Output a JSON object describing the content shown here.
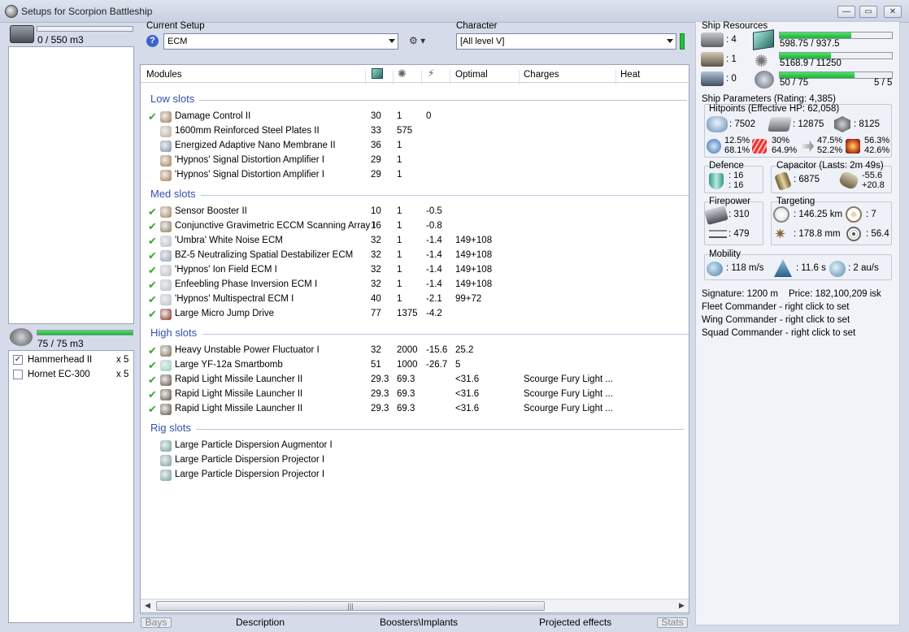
{
  "window": {
    "title": "Setups for Scorpion Battleship"
  },
  "left": {
    "cargo_value": "0 / 550 m3",
    "cargo_fill": 0,
    "drone_value": "75 / 75 m3",
    "drone_fill": 1,
    "drones": [
      {
        "name": "Hammerhead II",
        "count": "x 5",
        "checked": true
      },
      {
        "name": "Hornet EC-300",
        "count": "x 5",
        "checked": false
      }
    ]
  },
  "setup": {
    "label": "Current Setup",
    "value": "ECM"
  },
  "character": {
    "label": "Character",
    "value": "[All level V]"
  },
  "modules": {
    "headers": {
      "name": "Modules",
      "optimal": "Optimal",
      "charges": "Charges",
      "heat": "Heat"
    },
    "low": {
      "title": "Low slots",
      "items": [
        {
          "checked": true,
          "name": "Damage Control II",
          "c1": "30",
          "c2": "1",
          "c3": "0",
          "optimal": "",
          "charges": ""
        },
        {
          "checked": false,
          "name": "1600mm Reinforced Steel Plates II",
          "c1": "33",
          "c2": "575",
          "c3": "",
          "optimal": "",
          "charges": ""
        },
        {
          "checked": false,
          "name": "Energized Adaptive Nano Membrane II",
          "c1": "36",
          "c2": "1",
          "c3": "",
          "optimal": "",
          "charges": ""
        },
        {
          "checked": false,
          "name": "'Hypnos' Signal Distortion Amplifier I",
          "c1": "29",
          "c2": "1",
          "c3": "",
          "optimal": "",
          "charges": ""
        },
        {
          "checked": false,
          "name": "'Hypnos' Signal Distortion Amplifier I",
          "c1": "29",
          "c2": "1",
          "c3": "",
          "optimal": "",
          "charges": ""
        }
      ]
    },
    "med": {
      "title": "Med slots",
      "items": [
        {
          "checked": true,
          "name": "Sensor Booster II",
          "c1": "10",
          "c2": "1",
          "c3": "-0.5",
          "optimal": "",
          "charges": ""
        },
        {
          "checked": true,
          "name": "Conjunctive Gravimetric ECCM Scanning Array I",
          "c1": "16",
          "c2": "1",
          "c3": "-0.8",
          "optimal": "",
          "charges": ""
        },
        {
          "checked": true,
          "name": "'Umbra' White Noise ECM",
          "c1": "32",
          "c2": "1",
          "c3": "-1.4",
          "optimal": "149+108",
          "charges": ""
        },
        {
          "checked": true,
          "name": "BZ-5 Neutralizing Spatial Destabilizer ECM",
          "c1": "32",
          "c2": "1",
          "c3": "-1.4",
          "optimal": "149+108",
          "charges": ""
        },
        {
          "checked": true,
          "name": "'Hypnos' Ion Field ECM I",
          "c1": "32",
          "c2": "1",
          "c3": "-1.4",
          "optimal": "149+108",
          "charges": ""
        },
        {
          "checked": true,
          "name": "Enfeebling Phase Inversion ECM I",
          "c1": "32",
          "c2": "1",
          "c3": "-1.4",
          "optimal": "149+108",
          "charges": ""
        },
        {
          "checked": true,
          "name": "'Hypnos' Multispectral ECM I",
          "c1": "40",
          "c2": "1",
          "c3": "-2.1",
          "optimal": "99+72",
          "charges": ""
        },
        {
          "checked": true,
          "name": "Large Micro Jump Drive",
          "c1": "77",
          "c2": "1375",
          "c3": "-4.2",
          "optimal": "",
          "charges": ""
        }
      ]
    },
    "high": {
      "title": "High slots",
      "items": [
        {
          "checked": true,
          "name": "Heavy Unstable Power Fluctuator I",
          "c1": "32",
          "c2": "2000",
          "c3": "-15.6",
          "optimal": "25.2",
          "charges": ""
        },
        {
          "checked": true,
          "name": "Large YF-12a Smartbomb",
          "c1": "51",
          "c2": "1000",
          "c3": "-26.7",
          "optimal": "5",
          "charges": ""
        },
        {
          "checked": true,
          "name": "Rapid Light Missile Launcher II",
          "c1": "29.3",
          "c2": "69.3",
          "c3": "",
          "optimal": "<31.6",
          "charges": "Scourge Fury Light ..."
        },
        {
          "checked": true,
          "name": "Rapid Light Missile Launcher II",
          "c1": "29.3",
          "c2": "69.3",
          "c3": "",
          "optimal": "<31.6",
          "charges": "Scourge Fury Light ..."
        },
        {
          "checked": true,
          "name": "Rapid Light Missile Launcher II",
          "c1": "29.3",
          "c2": "69.3",
          "c3": "",
          "optimal": "<31.6",
          "charges": "Scourge Fury Light ..."
        }
      ]
    },
    "rig": {
      "title": "Rig slots",
      "items": [
        {
          "checked": false,
          "name": "Large Particle Dispersion Augmentor I",
          "c1": "",
          "c2": "",
          "c3": "",
          "optimal": "",
          "charges": ""
        },
        {
          "checked": false,
          "name": "Large Particle Dispersion Projector I",
          "c1": "",
          "c2": "",
          "c3": "",
          "optimal": "",
          "charges": ""
        },
        {
          "checked": false,
          "name": "Large Particle Dispersion Projector I",
          "c1": "",
          "c2": "",
          "c3": "",
          "optimal": "",
          "charges": ""
        }
      ]
    }
  },
  "tabs": {
    "bays": "Bays",
    "description": "Description",
    "boosters": "Boosters\\Implants",
    "projected": "Projected effects",
    "stats": "Stats"
  },
  "resources": {
    "title": "Ship Resources",
    "turrets": ": 4",
    "launchers": ": 1",
    "calibrations": ": 0",
    "cpu": "598.75 / 937.5",
    "cpu_fill": 0.639,
    "power": "5168.9 / 11250",
    "power_fill": 0.459,
    "drone_bw": "50 / 75",
    "drone_bw_fill": 0.667,
    "drones_active": "5 / 5"
  },
  "params": {
    "title": "Ship Parameters (Rating: 4,385)",
    "hitpoints_title": "Hitpoints (Effective HP: 62,058)",
    "shield_hp": ": 7502",
    "armor_hp": ": 12875",
    "structure_hp": ": 8125",
    "res_em": [
      "12.5%",
      "68.1%"
    ],
    "res_thermal": [
      "30%",
      "64.9%"
    ],
    "res_kinetic": [
      "47.5%",
      "52.2%"
    ],
    "res_explosive": [
      "56.3%",
      "42.6%"
    ],
    "defence_title": "Defence",
    "defence_a": ": 16",
    "defence_b": ": 16",
    "capacitor_title": "Capacitor (Lasts: 2m 49s)",
    "capacitor_value": ": 6875",
    "cap_delta_a": "-55.6",
    "cap_delta_b": "+20.8",
    "firepower_title": "Firepower",
    "firepower_a": ": 310",
    "firepower_b": ": 479",
    "targeting_title": "Targeting",
    "target_range": ": 146.25 km",
    "target_count": ": 7",
    "scan_res": ": 178.8 mm",
    "sig": ": 56.4",
    "mobility_title": "Mobility",
    "speed": ": 118 m/s",
    "align": ": 11.6 s",
    "warp": ": 2 au/s",
    "signature": "Signature: 1200 m",
    "price": "Price: 182,100,209 isk",
    "fleet": "Fleet Commander - right click to set",
    "wing": "Wing Commander - right click to set",
    "squad": "Squad Commander - right click to set"
  },
  "colors": {
    "accent": "#3350a8",
    "check": "#3aa830",
    "bar_fill": "#1fbf3a"
  }
}
